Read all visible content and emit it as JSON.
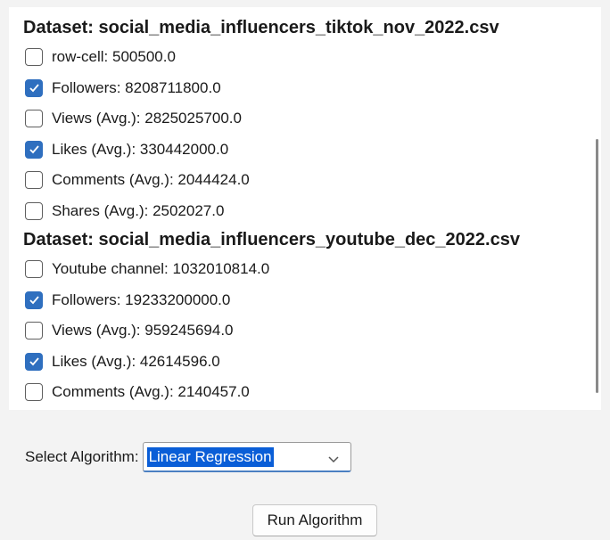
{
  "datasets": [
    {
      "header": "Dataset: social_media_influencers_tiktok_nov_2022.csv",
      "items": [
        {
          "label": "row-cell: 500500.0",
          "checked": false
        },
        {
          "label": "Followers: 8208711800.0",
          "checked": true
        },
        {
          "label": "Views (Avg.): 2825025700.0",
          "checked": false
        },
        {
          "label": "Likes (Avg.): 330442000.0",
          "checked": true
        },
        {
          "label": "Comments (Avg.): 2044424.0",
          "checked": false
        },
        {
          "label": "Shares (Avg.): 2502027.0",
          "checked": false
        }
      ]
    },
    {
      "header": "Dataset: social_media_influencers_youtube_dec_2022.csv",
      "items": [
        {
          "label": "Youtube channel: 1032010814.0",
          "checked": false
        },
        {
          "label": "Followers: 19233200000.0",
          "checked": true
        },
        {
          "label": "Views (Avg.): 959245694.0",
          "checked": false
        },
        {
          "label": "Likes (Avg.): 42614596.0",
          "checked": true
        },
        {
          "label": "Comments (Avg.): 2140457.0",
          "checked": false
        }
      ]
    }
  ],
  "algorithm": {
    "label": "Select Algorithm:",
    "selected": "Linear Regression"
  },
  "run_button": {
    "label": "Run Algorithm"
  },
  "colors": {
    "checkbox_checked": "#2f6fbf",
    "selection_highlight": "#0a5ed7"
  }
}
